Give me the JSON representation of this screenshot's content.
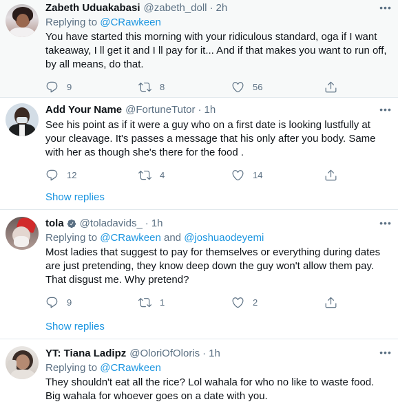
{
  "tweets": [
    {
      "name": "Zabeth Uduakabasi",
      "handle": "@zabeth_doll",
      "time": "2h",
      "replying_prefix": "Replying to",
      "replying_to": "@CRawkeen",
      "replying_join": "",
      "replying_to_2": "",
      "text": "You have started this morning with your ridiculous standard, oga if I want takeaway, I ll get it and I ll pay for it... And if that makes you want to run off, by all means, do that.",
      "replies": "9",
      "retweets": "8",
      "likes": "56"
    },
    {
      "name": "Add Your Name",
      "handle": "@FortuneTutor",
      "time": "1h",
      "text": "See his point as if it were a guy who on a first date is looking lustfully at your cleavage.  It's passes a message that his only after you body. Same with her as though she's there for the food .",
      "replies": "12",
      "retweets": "4",
      "likes": "14",
      "show_replies": "Show replies"
    },
    {
      "name": "tola",
      "handle": "@toladavids_",
      "time": "1h",
      "replying_prefix": "Replying to",
      "replying_to": "@CRawkeen",
      "replying_join": "and",
      "replying_to_2": "@joshuaodeyemi",
      "text": "Most ladies that suggest to pay for themselves or everything during dates are just pretending, they know deep down the guy won't allow them pay. That disgust me. Why pretend?",
      "replies": "9",
      "retweets": "1",
      "likes": "2",
      "show_replies": "Show replies"
    },
    {
      "name": "YT: Tiana Ladipz",
      "handle": "@OloriOfOloris",
      "time": "1h",
      "replying_prefix": "Replying to",
      "replying_to": "@CRawkeen",
      "text": "They shouldn't eat all the rice? Lol wahala for who no like to waste food. Big wahala for whoever goes on a date with you."
    }
  ],
  "dot": "·",
  "icons": {
    "reply": "reply-icon",
    "retweet": "retweet-icon",
    "like": "heart-icon",
    "share": "share-icon",
    "more": "more-icon",
    "verified": "verified-badge-icon"
  },
  "colors": {
    "link": "#1b95e0",
    "secondary": "#5b7083",
    "divider": "#e1e8ed",
    "highlight_bg": "#f7f9f9"
  }
}
